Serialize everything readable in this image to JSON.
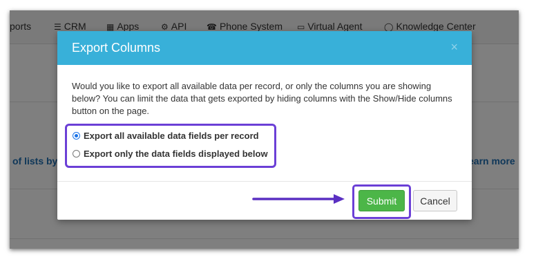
{
  "nav": {
    "items": [
      {
        "label": "ports",
        "icon": ""
      },
      {
        "label": "CRM",
        "icon": "list-icon"
      },
      {
        "label": "Apps",
        "icon": "grid-icon"
      },
      {
        "label": "API",
        "icon": "gear-icon"
      },
      {
        "label": "Phone System",
        "icon": "phone-icon"
      },
      {
        "label": "Virtual Agent",
        "icon": "monitor-icon"
      },
      {
        "label": "Knowledge Center",
        "icon": "lightbulb-icon"
      }
    ]
  },
  "background": {
    "left_link": "of lists by",
    "right_link": "earn more"
  },
  "modal": {
    "title": "Export Columns",
    "close_glyph": "×",
    "description": "Would you like to export all available data per record, or only the columns you are showing below? You can limit the data that gets exported by hiding columns with the Show/Hide columns button on the page.",
    "options": [
      {
        "label": "Export all available data fields per record",
        "selected": true
      },
      {
        "label": "Export only the data fields displayed below",
        "selected": false
      }
    ],
    "submit_label": "Submit",
    "cancel_label": "Cancel"
  },
  "colors": {
    "header": "#38b0d9",
    "highlight": "#6b3fd6",
    "submit": "#4cb648"
  }
}
